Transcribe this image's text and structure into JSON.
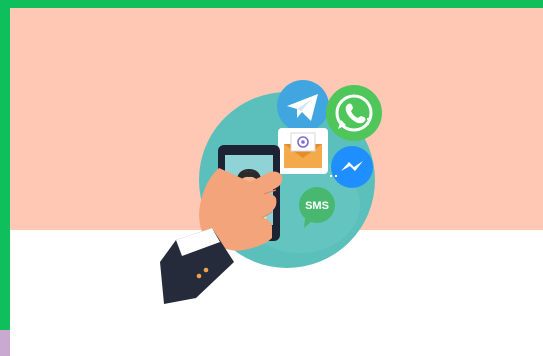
{
  "illustration": {
    "sms_bubble_text": "SMS",
    "icons": [
      "telegram-icon",
      "whatsapp-icon",
      "email-envelope-icon",
      "messenger-icon",
      "sms-bubble-icon",
      "customer-support-agent-icon"
    ]
  },
  "colors": {
    "frame_border": "#0fbf5c",
    "peach_background": "#fec8b4",
    "circle_teal": "#5bbfbb",
    "telegram": "#41a6e0",
    "whatsapp": "#4fc65a",
    "messenger": "#1f8fff",
    "sms": "#48b870",
    "sleeve": "#262b3b"
  }
}
